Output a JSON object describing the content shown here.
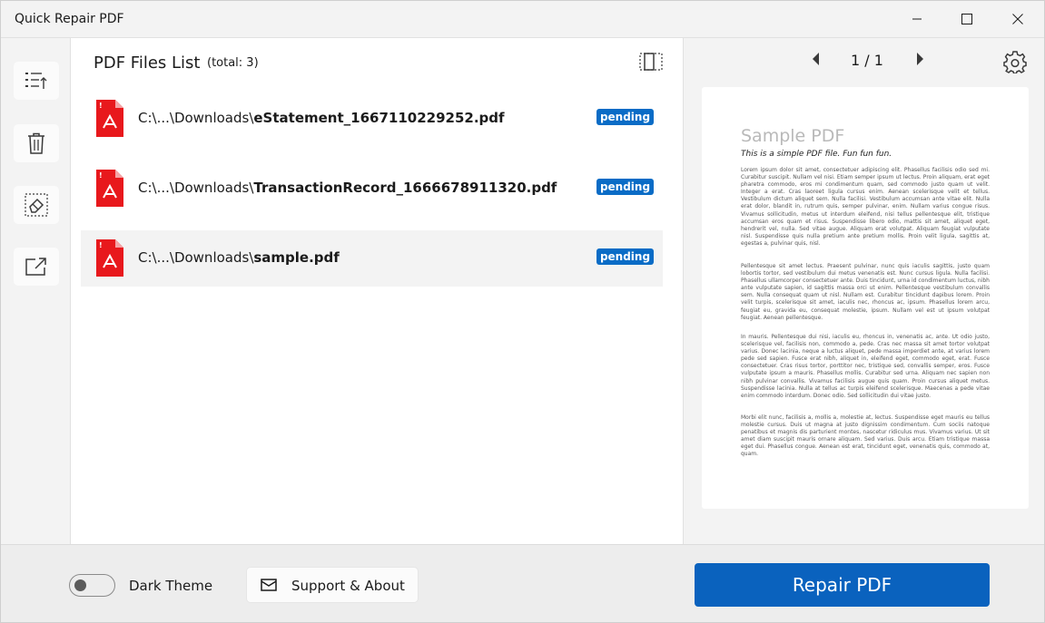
{
  "window": {
    "title": "Quick Repair PDF"
  },
  "toolbar": {
    "items": [
      "add-files",
      "delete",
      "clear",
      "export"
    ]
  },
  "file_list": {
    "title": "PDF Files List",
    "total": "(total: 3)",
    "files": [
      {
        "dir": "C:\\...\\Downloads\\",
        "name": "eStatement_1667110229252.pdf",
        "status": "pending"
      },
      {
        "dir": "C:\\...\\Downloads\\",
        "name": "TransactionRecord_1666678911320.pdf",
        "status": "pending"
      },
      {
        "dir": "C:\\...\\Downloads\\",
        "name": "sample.pdf",
        "status": "pending"
      }
    ]
  },
  "preview": {
    "page_indicator": "1 / 1",
    "doc_title": "Sample PDF",
    "doc_subtitle": "This is a simple PDF file. Fun fun fun.",
    "paragraphs": [
      "Lorem ipsum dolor sit amet, consectetuer adipiscing elit. Phasellus facilisis odio sed mi. Curabitur suscipit. Nullam vel nisi. Etiam semper ipsum ut lectus. Proin aliquam, erat eget pharetra commodo, eros mi condimentum quam, sed commodo justo quam ut velit. Integer a erat. Cras laoreet ligula cursus enim. Aenean scelerisque velit et tellus. Vestibulum dictum aliquet sem. Nulla facilisi. Vestibulum accumsan ante vitae elit. Nulla erat dolor, blandit in, rutrum quis, semper pulvinar, enim. Nullam varius congue risus. Vivamus sollicitudin, metus ut interdum eleifend, nisi tellus pellentesque elit, tristique accumsan eros quam et risus. Suspendisse libero odio, mattis sit amet, aliquet eget, hendrerit vel, nulla. Sed vitae augue. Aliquam erat volutpat. Aliquam feugiat vulputate nisl. Suspendisse quis nulla pretium ante pretium mollis. Proin velit ligula, sagittis at, egestas a, pulvinar quis, nisl.",
      "Pellentesque sit amet lectus. Praesent pulvinar, nunc quis iaculis sagittis, justo quam lobortis tortor, sed vestibulum dui metus venenatis est. Nunc cursus ligula. Nulla facilisi. Phasellus ullamcorper consectetuer ante. Duis tincidunt, urna id condimentum luctus, nibh ante vulputate sapien, id sagittis massa orci ut enim. Pellentesque vestibulum convallis sem. Nulla consequat quam ut nisl. Nullam est. Curabitur tincidunt dapibus lorem. Proin velit turpis, scelerisque sit amet, iaculis nec, rhoncus ac, ipsum. Phasellus lorem arcu, feugiat eu, gravida eu, consequat molestie, ipsum. Nullam vel est ut ipsum volutpat feugiat. Aenean pellentesque.",
      "In mauris. Pellentesque dui nisi, iaculis eu, rhoncus in, venenatis ac, ante. Ut odio justo, scelerisque vel, facilisis non, commodo a, pede. Cras nec massa sit amet tortor volutpat varius. Donec lacinia, neque a luctus aliquet, pede massa imperdiet ante, at varius lorem pede sed sapien. Fusce erat nibh, aliquet in, eleifend eget, commodo eget, erat. Fusce consectetuer. Cras risus tortor, porttitor nec, tristique sed, convallis semper, eros. Fusce vulputate ipsum a mauris. Phasellus mollis. Curabitur sed urna. Aliquam nec sapien non nibh pulvinar convallis. Vivamus facilisis augue quis quam. Proin cursus aliquet metus. Suspendisse lacinia. Nulla at tellus ac turpis eleifend scelerisque. Maecenas a pede vitae enim commodo interdum. Donec odio. Sed sollicitudin dui vitae justo.",
      "Morbi elit nunc, facilisis a, mollis a, molestie at, lectus. Suspendisse eget mauris eu tellus molestie cursus. Duis ut magna at justo dignissim condimentum. Cum sociis natoque penatibus et magnis dis parturient montes, nascetur ridiculus mus. Vivamus varius. Ut sit amet diam suscipit mauris ornare aliquam. Sed varius. Duis arcu. Etiam tristique massa eget dui. Phasellus congue. Aenean est erat, tincidunt eget, venenatis quis, commodo at, quam."
    ]
  },
  "bottom": {
    "theme_label": "Dark Theme",
    "support_label": "Support & About",
    "repair_label": "Repair PDF"
  },
  "colors": {
    "accent": "#0a62be",
    "badge": "#0a6cc6",
    "pdf_red": "#e8181c"
  }
}
